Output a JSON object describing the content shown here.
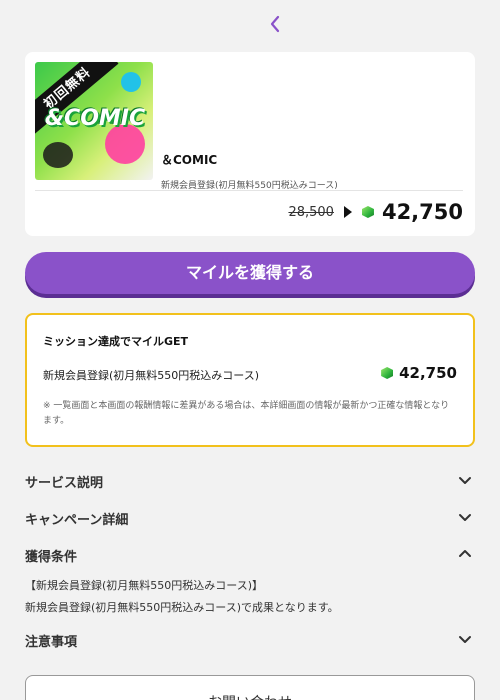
{
  "nav": {
    "back_icon": "chevron-left-icon",
    "accent": "#8a52c9"
  },
  "offer": {
    "thumb_ribbon": "初回無料",
    "thumb_logo": "&COMIC",
    "title": "＆COMIC",
    "subtitle": "新規会員登録(初月無料550円税込みコース)",
    "old_price": "28,500",
    "new_price": "42,750"
  },
  "cta": {
    "label": "マイルを獲得する",
    "color": "#8a52c9"
  },
  "mission": {
    "title": "ミッション達成でマイルGET",
    "item_label": "新規会員登録(初月無料550円税込みコース)",
    "item_price": "42,750",
    "note": "※ 一覧画面と本画面の報酬情報に差異がある場合は、本詳細画面の情報が最新かつ正確な情報となります。",
    "border_color": "#f2c11c"
  },
  "sections": {
    "service": "サービス説明",
    "campaign": "キャンペーン詳細",
    "conditions": "獲得条件",
    "conditions_line1": "【新規会員登録(初月無料550円税込みコース)】",
    "conditions_line2": "新規会員登録(初月無料550円税込みコース)で成果となります。",
    "notes": "注意事項"
  },
  "inquiry": {
    "label": "お問い合わせ"
  }
}
